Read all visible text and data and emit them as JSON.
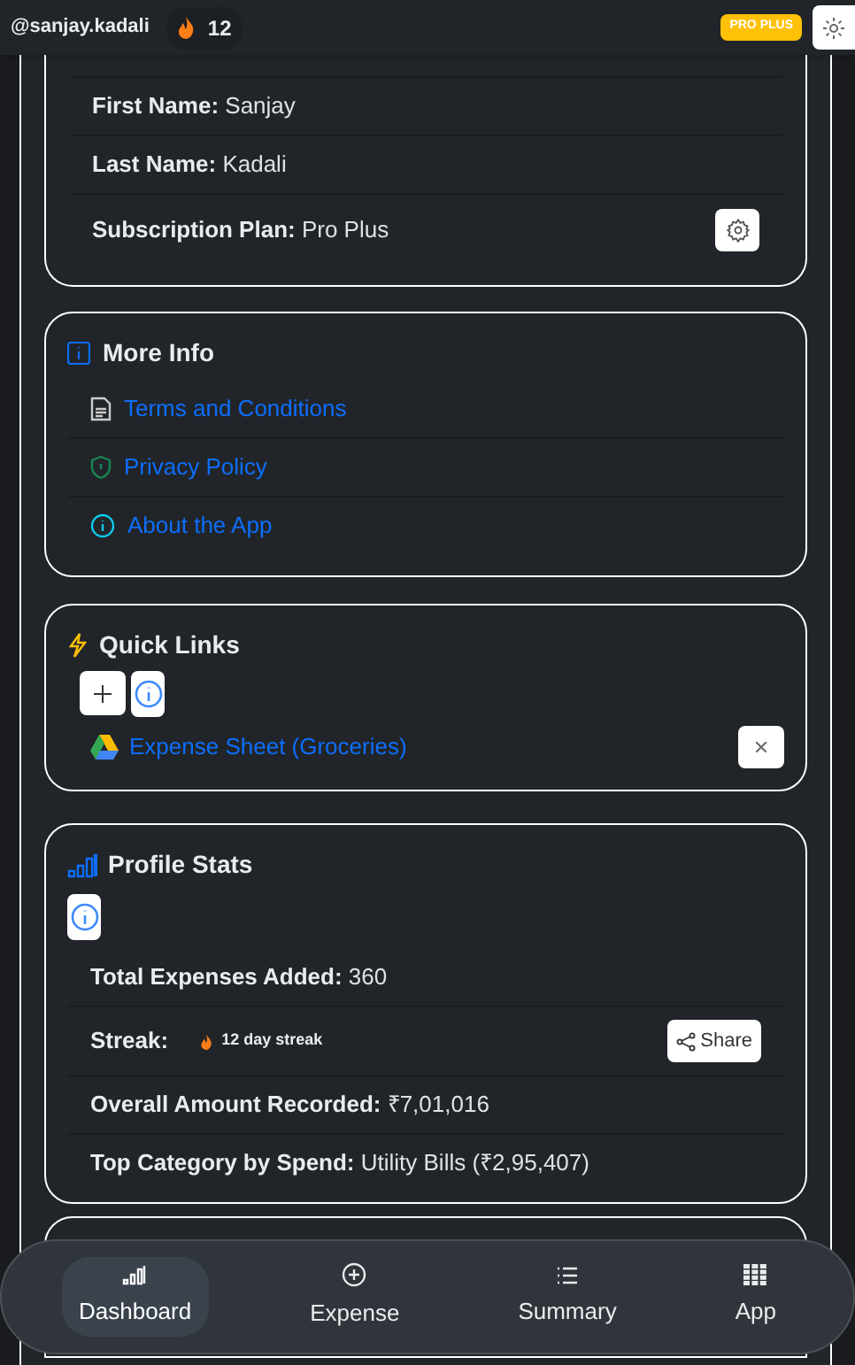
{
  "header": {
    "username": "@sanjay.kadali",
    "streak": "12",
    "badge": "PRO PLUS"
  },
  "profile": {
    "rows": [
      {
        "label": "First Name:",
        "value": "Sanjay",
        "kind": "text"
      },
      {
        "label": "Last Name:",
        "value": "Kadali",
        "kind": "text"
      },
      {
        "label": "Subscription Plan:",
        "value": "Pro Plus",
        "kind": "settings"
      }
    ]
  },
  "more_info": {
    "title": "More Info",
    "links": [
      {
        "label": "Terms and Conditions",
        "kind": "document"
      },
      {
        "label": "Privacy Policy",
        "kind": "shield"
      },
      {
        "label": "About the App",
        "kind": "info"
      }
    ]
  },
  "quick_links": {
    "title": "Quick Links",
    "links": [
      {
        "label": "Expense Sheet (Groceries)"
      }
    ]
  },
  "profile_stats": {
    "title": "Profile Stats",
    "rows": [
      {
        "label": "Total Expenses Added:",
        "value": "360",
        "kind": "text"
      },
      {
        "label": "Streak:",
        "value": "12 day streak",
        "kind": "streak",
        "action": "Share"
      },
      {
        "label": "Overall Amount Recorded:",
        "value": "₹7,01,016",
        "kind": "text"
      },
      {
        "label": "Top Category by Spend:",
        "value": "Utility Bills (₹2,95,407)",
        "kind": "text"
      }
    ]
  },
  "nav": [
    {
      "label": "Dashboard",
      "kind": "bars",
      "selected": true
    },
    {
      "label": "Expense",
      "kind": "plus",
      "selected": false
    },
    {
      "label": "Summary",
      "kind": "list",
      "selected": false
    },
    {
      "label": "App",
      "kind": "grid",
      "selected": false
    }
  ]
}
